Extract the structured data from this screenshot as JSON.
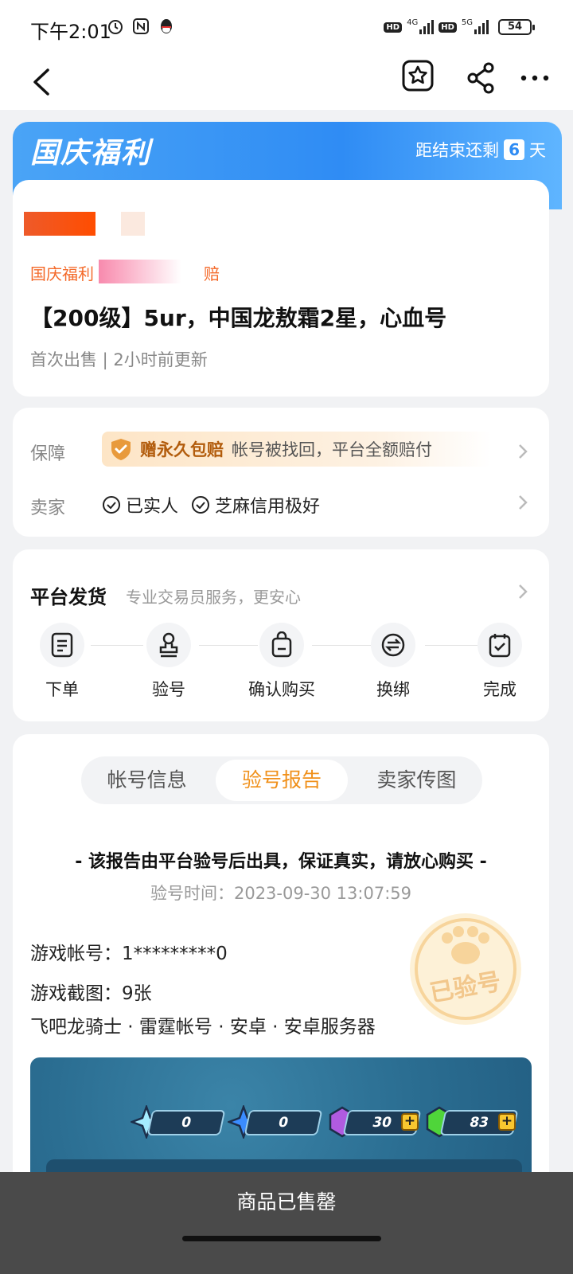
{
  "status_bar": {
    "time": "下午2:01",
    "net1": "4G",
    "net2": "5G",
    "battery": "54"
  },
  "promo": {
    "title": "国庆福利",
    "countdown_prefix": "距结束还剩",
    "days": "6",
    "days_unit": "天"
  },
  "product": {
    "promo_tag": "国庆福利",
    "promo_tag_tail": "赔",
    "title": "【200级】5ur，中国龙敖霜2星，心血号",
    "meta": "首次出售 | 2小时前更新"
  },
  "guarantee": {
    "label": "保障",
    "badge": "赠永久包赔",
    "text": "帐号被找回，平台全额赔付",
    "seller_label": "卖家",
    "seller_tags": [
      "已实人",
      "芝麻信用极好"
    ]
  },
  "delivery": {
    "title": "平台发货",
    "subtitle": "专业交易员服务，更安心",
    "steps": [
      {
        "label": "下单",
        "icon": "order-icon"
      },
      {
        "label": "验号",
        "icon": "stamp-icon"
      },
      {
        "label": "确认购买",
        "icon": "bag-icon"
      },
      {
        "label": "换绑",
        "icon": "swap-icon"
      },
      {
        "label": "完成",
        "icon": "done-icon"
      }
    ]
  },
  "report": {
    "tabs": [
      "帐号信息",
      "验号报告",
      "卖家传图"
    ],
    "active_tab": 1,
    "note": "- 该报告由平台验号后出具，保证真实，请放心购买 -",
    "time": "验号时间：2023-09-30 13:07:59",
    "account": "游戏帐号：1*********0",
    "screenshots": "游戏截图：9张",
    "attributes": "飞吧龙骑士 · 雷霆帐号 · 安卓 · 安卓服务器",
    "stamp_text": "已验号",
    "game_resources": [
      "0",
      "0",
      "30",
      "83"
    ]
  },
  "footer": {
    "sold_label": "商品已售罄"
  },
  "colors": {
    "accent": "#f0901a",
    "promo_blue": "#2f8cf4",
    "orange_red": "#f46a2a"
  }
}
